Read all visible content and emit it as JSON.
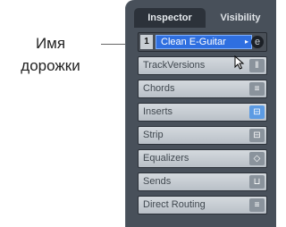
{
  "callout": {
    "line1": "Имя",
    "line2": "дорожки"
  },
  "tabs": {
    "inspector": "Inspector",
    "visibility": "Visibility"
  },
  "track": {
    "number": "1",
    "name": "Clean E-Guitar",
    "arrow": "▸",
    "edit_symbol": "e"
  },
  "sections": [
    {
      "label": "TrackVersions",
      "icon": "‖",
      "icon_name": "track-versions-icon"
    },
    {
      "label": "Chords",
      "icon": "≡",
      "icon_name": "chords-icon"
    },
    {
      "label": "Inserts",
      "icon": "⊟",
      "icon_name": "inserts-icon"
    },
    {
      "label": "Strip",
      "icon": "⊟",
      "icon_name": "strip-icon"
    },
    {
      "label": "Equalizers",
      "icon": "◇",
      "icon_name": "equalizers-icon"
    },
    {
      "label": "Sends",
      "icon": "⊔",
      "icon_name": "sends-icon"
    },
    {
      "label": "Direct Routing",
      "icon": "≡",
      "icon_name": "direct-routing-icon"
    }
  ],
  "colors": {
    "accent": "#2f6fe0",
    "panel": "#48505a",
    "highlight_button": "#5c9be3"
  }
}
